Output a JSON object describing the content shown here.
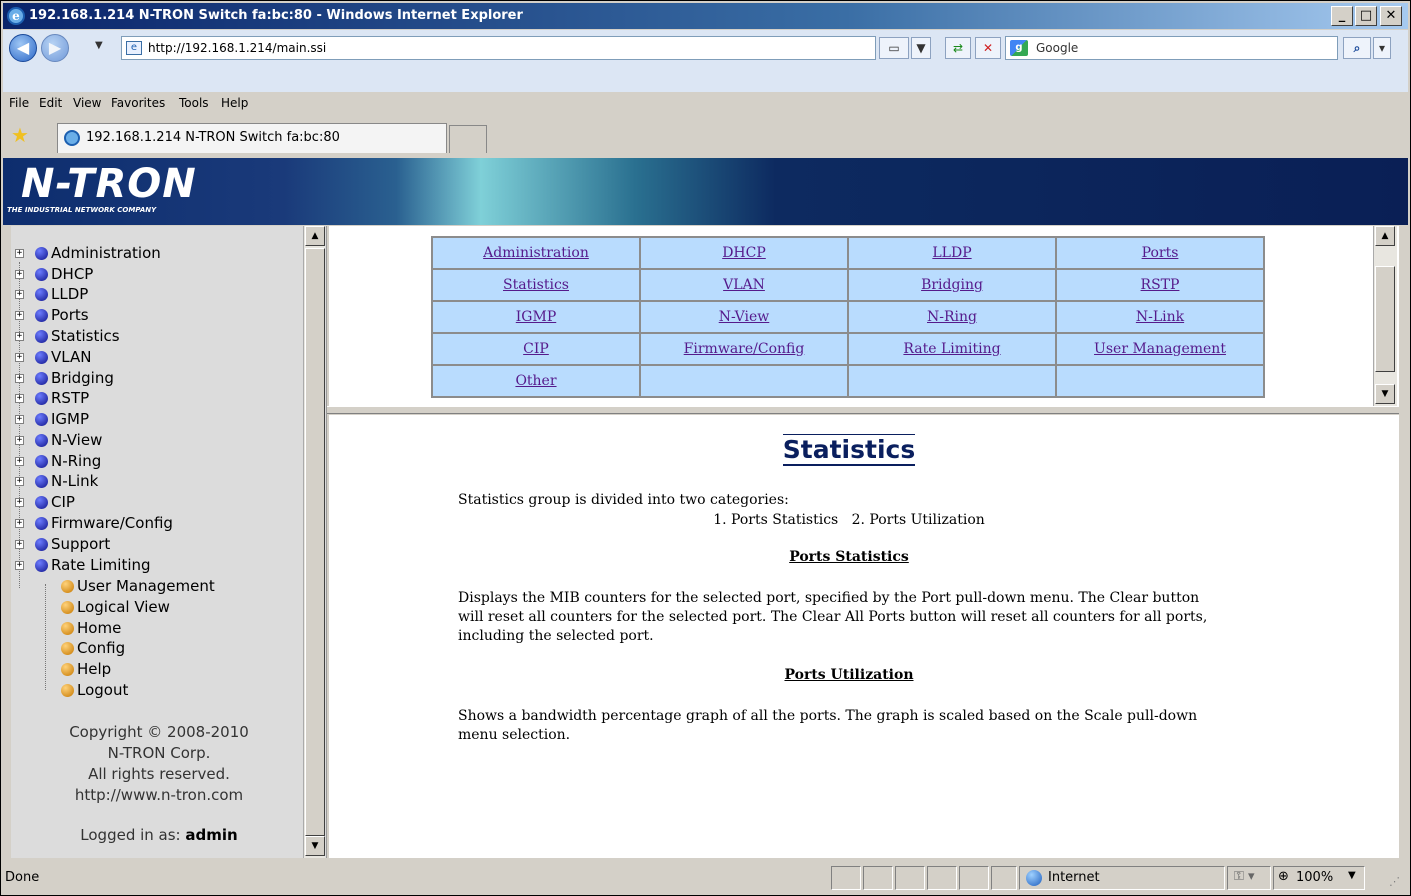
{
  "window": {
    "title": "192.168.1.214 N-TRON Switch fa:bc:80 - Windows Internet Explorer"
  },
  "addressbar": {
    "url": "http://192.168.1.214/main.ssi",
    "search_placeholder": "Google"
  },
  "menu": [
    "File",
    "Edit",
    "View",
    "Favorites",
    "Tools",
    "Help"
  ],
  "tab": {
    "label": "192.168.1.214 N-TRON Switch fa:bc:80"
  },
  "banner": {
    "logo": "N-TRON",
    "tagline": "THE INDUSTRIAL NETWORK COMPANY"
  },
  "sidebar": {
    "groups": [
      {
        "label": "Administration",
        "icon": "blue-bullet-icon"
      },
      {
        "label": "DHCP",
        "icon": "blue-bullet-icon"
      },
      {
        "label": "LLDP",
        "icon": "blue-bullet-icon"
      },
      {
        "label": "Ports",
        "icon": "blue-bullet-icon"
      },
      {
        "label": "Statistics",
        "icon": "blue-bullet-icon"
      },
      {
        "label": "VLAN",
        "icon": "blue-bullet-icon"
      },
      {
        "label": "Bridging",
        "icon": "blue-bullet-icon"
      },
      {
        "label": "RSTP",
        "icon": "blue-bullet-icon"
      },
      {
        "label": "IGMP",
        "icon": "blue-bullet-icon"
      },
      {
        "label": "N-View",
        "icon": "blue-bullet-icon"
      },
      {
        "label": "N-Ring",
        "icon": "blue-bullet-icon"
      },
      {
        "label": "N-Link",
        "icon": "blue-bullet-icon"
      },
      {
        "label": "CIP",
        "icon": "blue-bullet-icon"
      },
      {
        "label": "Firmware/Config",
        "icon": "blue-bullet-icon"
      },
      {
        "label": "Support",
        "icon": "blue-bullet-icon"
      },
      {
        "label": "Rate Limiting",
        "icon": "blue-bullet-icon"
      }
    ],
    "links": [
      {
        "label": "User Management",
        "icon": "orange-bullet-icon"
      },
      {
        "label": "Logical View",
        "icon": "orange-bullet-icon"
      },
      {
        "label": "Home",
        "icon": "orange-bullet-icon"
      },
      {
        "label": "Config",
        "icon": "orange-bullet-icon"
      },
      {
        "label": "Help",
        "icon": "orange-bullet-icon"
      },
      {
        "label": "Logout",
        "icon": "orange-bullet-icon"
      }
    ],
    "copyright": [
      "Copyright © 2008-2010",
      "N-TRON Corp.",
      "All rights reserved.",
      "http://www.n-tron.com"
    ],
    "logged_in_prefix": "Logged in as:",
    "logged_in_user": "admin"
  },
  "linkgrid": [
    [
      "Administration",
      "DHCP",
      "LLDP",
      "Ports"
    ],
    [
      "Statistics",
      "VLAN",
      "Bridging",
      "RSTP"
    ],
    [
      "IGMP",
      "N-View",
      "N-Ring",
      "N-Link"
    ],
    [
      "CIP",
      "Firmware/Config",
      "Rate Limiting",
      "User Management"
    ],
    [
      "Other",
      "",
      "",
      ""
    ]
  ],
  "content": {
    "title": "Statistics",
    "intro": "Statistics group is divided into two categories:",
    "categories": "1. Ports Statistics   2. Ports Utilization",
    "section1_title": "Ports Statistics",
    "section1_text": "Displays the MIB counters for the selected port, specified by the Port pull-down menu. The Clear button will reset all counters for the selected port. The Clear All Ports button will reset all counters for all ports, including the selected port.",
    "section2_title": "Ports Utilization",
    "section2_text": "Shows a bandwidth percentage graph of all the ports. The graph is scaled based on the Scale pull-down menu selection."
  },
  "statusbar": {
    "status": "Done",
    "zone": "Internet",
    "zoom": "100%"
  },
  "colors": {
    "title_bar": "#0a246a",
    "grid_cell": "#b9dcfe",
    "link": "#551a8b",
    "heading": "#0a1f5e"
  }
}
